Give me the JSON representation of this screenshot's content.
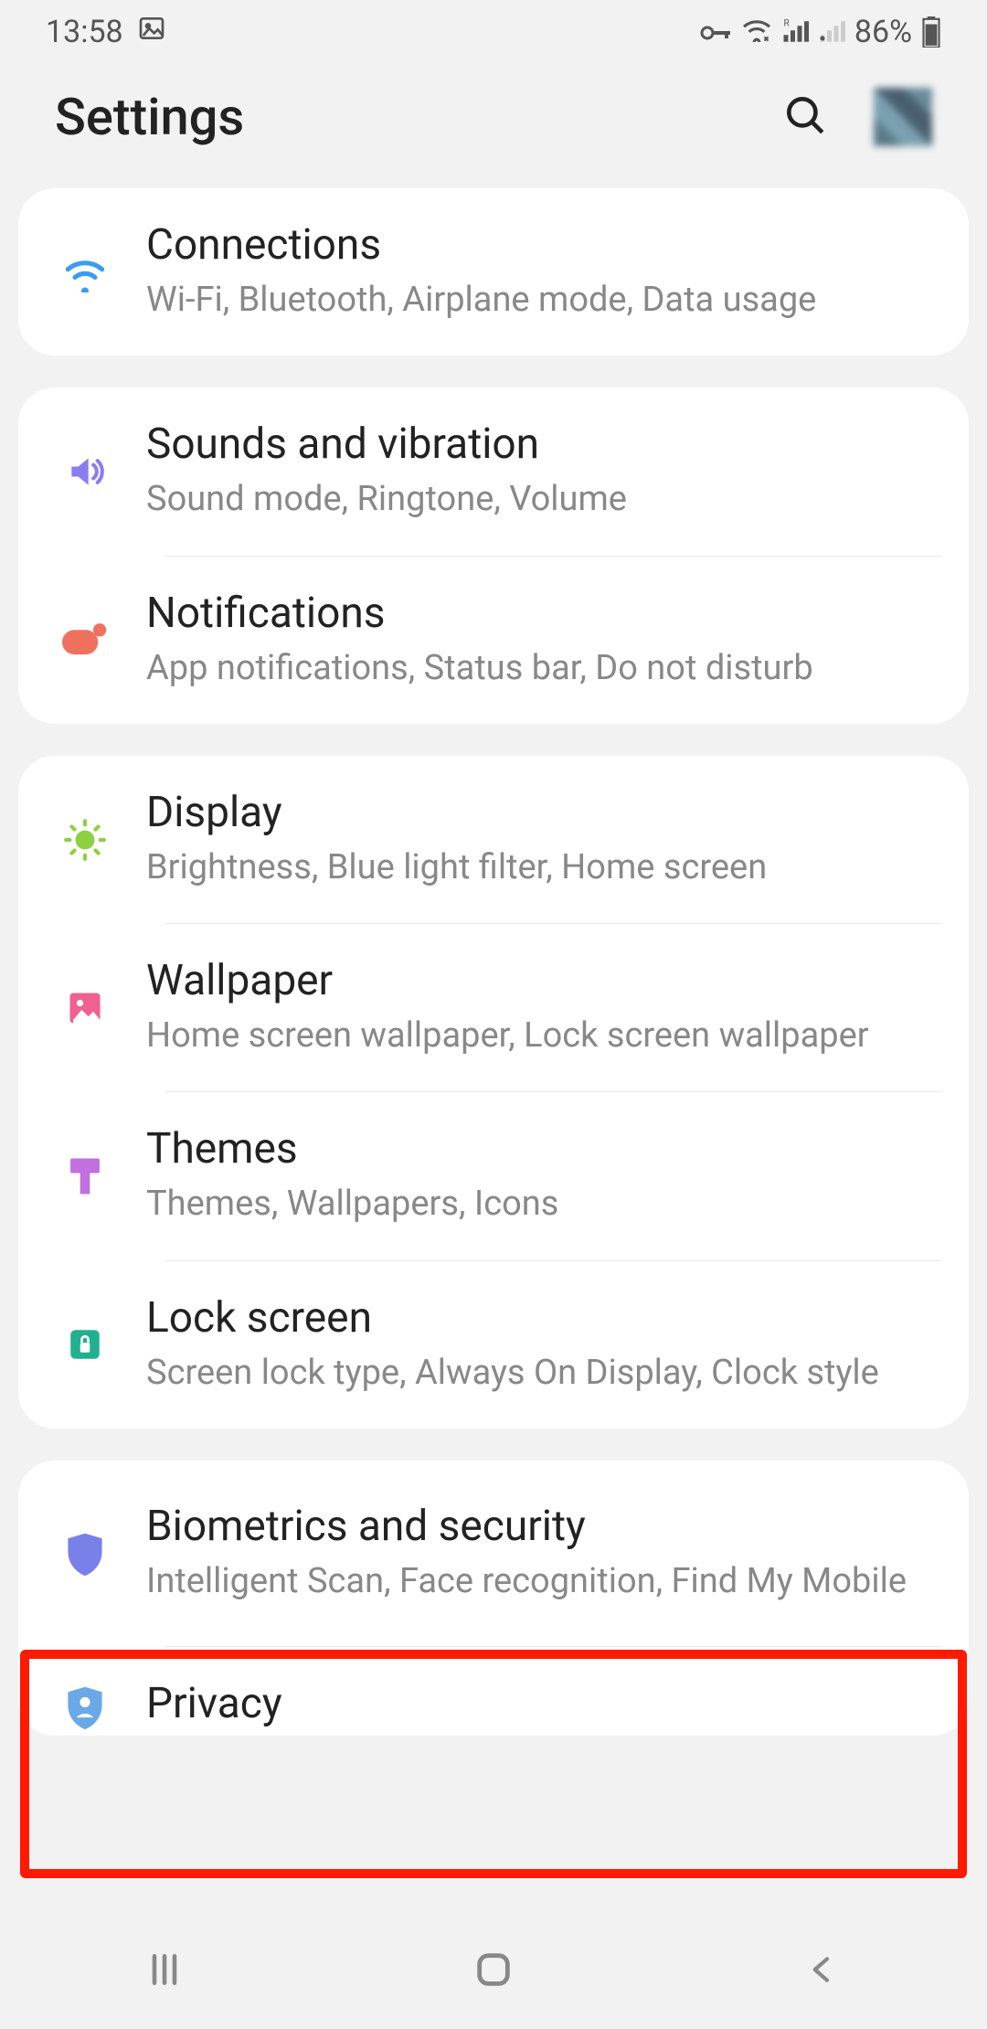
{
  "statusBar": {
    "time": "13:58",
    "battery": "86%"
  },
  "header": {
    "title": "Settings"
  },
  "groups": [
    {
      "items": [
        {
          "icon": "wifi",
          "color": "#3a9cf0",
          "title": "Connections",
          "subtitle": "Wi-Fi, Bluetooth, Airplane mode, Data usage"
        }
      ]
    },
    {
      "items": [
        {
          "icon": "sound",
          "color": "#8a7cf0",
          "title": "Sounds and vibration",
          "subtitle": "Sound mode, Ringtone, Volume"
        },
        {
          "icon": "notification",
          "color": "#f07060",
          "title": "Notifications",
          "subtitle": "App notifications, Status bar, Do not disturb"
        }
      ]
    },
    {
      "items": [
        {
          "icon": "display",
          "color": "#8dd040",
          "title": "Display",
          "subtitle": "Brightness, Blue light filter, Home screen"
        },
        {
          "icon": "wallpaper",
          "color": "#f06090",
          "title": "Wallpaper",
          "subtitle": "Home screen wallpaper, Lock screen wallpaper"
        },
        {
          "icon": "themes",
          "color": "#c070e0",
          "title": "Themes",
          "subtitle": "Themes, Wallpapers, Icons"
        },
        {
          "icon": "lock",
          "color": "#20b090",
          "title": "Lock screen",
          "subtitle": "Screen lock type, Always On Display, Clock style"
        }
      ]
    },
    {
      "items": [
        {
          "icon": "shield",
          "color": "#7a80ea",
          "title": "Biometrics and security",
          "subtitle": "Intelligent Scan, Face recognition, Find My Mobile",
          "highlight": true
        },
        {
          "icon": "privacy",
          "color": "#6aa8e8",
          "title": "Privacy",
          "subtitle": ""
        }
      ]
    }
  ]
}
